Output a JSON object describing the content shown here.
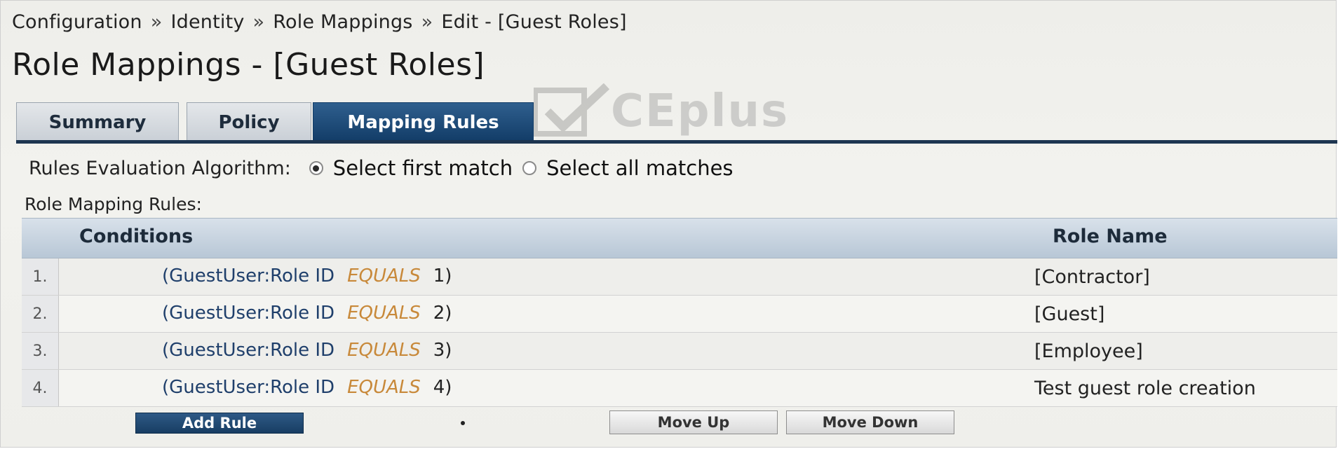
{
  "breadcrumb": [
    "Configuration",
    "Identity",
    "Role Mappings",
    "Edit - [Guest Roles]"
  ],
  "breadcrumb_sep": "»",
  "page_title": "Role Mappings - [Guest Roles]",
  "tabs": [
    {
      "label": "Summary",
      "active": false
    },
    {
      "label": "Policy",
      "active": false
    },
    {
      "label": "Mapping Rules",
      "active": true
    }
  ],
  "algorithm": {
    "label": "Rules Evaluation Algorithm:",
    "options": [
      {
        "label": "Select first match",
        "selected": true
      },
      {
        "label": "Select all matches",
        "selected": false
      }
    ]
  },
  "rules_label": "Role Mapping Rules:",
  "table": {
    "headers": {
      "conditions": "Conditions",
      "role_name": "Role Name"
    },
    "rows": [
      {
        "num": "1.",
        "open": "(",
        "attr": "GuestUser:Role ID",
        "op": "EQUALS",
        "value": "1)",
        "role": "[Contractor]"
      },
      {
        "num": "2.",
        "open": "(",
        "attr": "GuestUser:Role ID",
        "op": "EQUALS",
        "value": "2)",
        "role": "[Guest]"
      },
      {
        "num": "3.",
        "open": "(",
        "attr": "GuestUser:Role ID",
        "op": "EQUALS",
        "value": "3)",
        "role": "[Employee]"
      },
      {
        "num": "4.",
        "open": "(",
        "attr": "GuestUser:Role ID",
        "op": "EQUALS",
        "value": "4)",
        "role": "Test guest role creation"
      }
    ]
  },
  "buttons": {
    "add_rule": "Add Rule",
    "move_up": "Move Up",
    "move_down": "Move Down"
  },
  "watermark": "CEplus",
  "colors": {
    "tab_active": "#123c67",
    "condition_op": "#c8893a",
    "condition_attr": "#1f3f6b"
  }
}
